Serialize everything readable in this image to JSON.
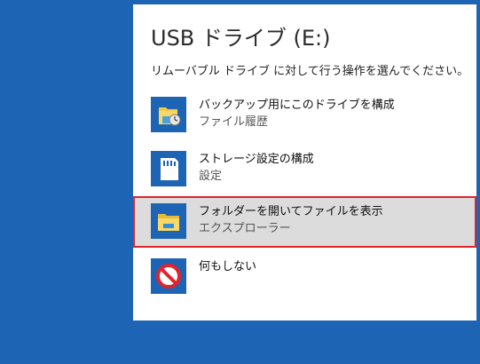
{
  "dialog": {
    "title": "USB ドライブ (E:)",
    "prompt": "リムーバブル ドライブ に対して行う操作を選んでください。",
    "options": [
      {
        "label": "バックアップ用にこのドライブを構成",
        "sublabel": "ファイル履歴",
        "icon": "file-history-icon",
        "selected": false
      },
      {
        "label": "ストレージ設定の構成",
        "sublabel": "設定",
        "icon": "sd-card-icon",
        "selected": false
      },
      {
        "label": "フォルダーを開いてファイルを表示",
        "sublabel": "エクスプローラー",
        "icon": "folder-icon",
        "selected": true
      },
      {
        "label": "何もしない",
        "sublabel": "",
        "icon": "no-action-icon",
        "selected": false
      }
    ]
  },
  "colors": {
    "desktop": "#1e64b4",
    "tile": "#1e64b4",
    "selected_background": "#dcdcdc",
    "selected_border": "#e0242c"
  }
}
